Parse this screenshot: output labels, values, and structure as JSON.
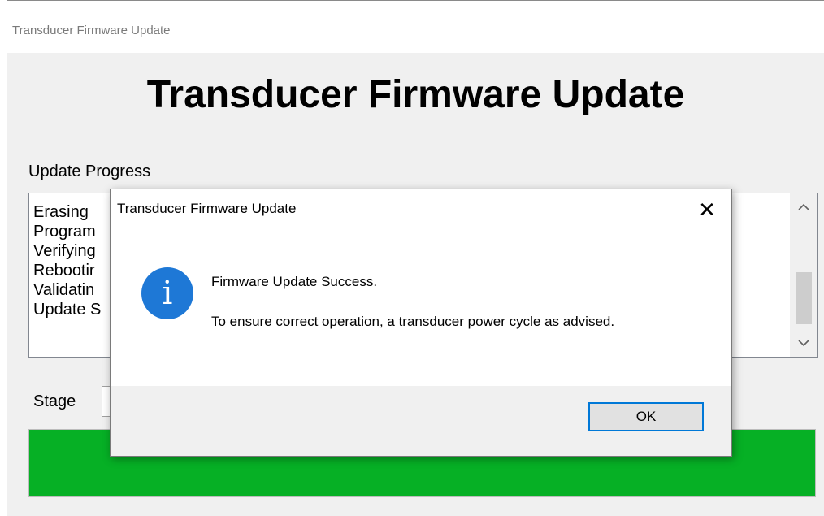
{
  "window": {
    "title": "Transducer Firmware Update",
    "heading": "Transducer Firmware Update"
  },
  "progress": {
    "label": "Update Progress",
    "items": [
      "Erasing",
      "Program",
      "Verifying",
      "Rebootir",
      "Validatin",
      "Update S"
    ],
    "scroll_up_icon": "chevron-up-icon",
    "scroll_down_icon": "chevron-down-icon"
  },
  "stage": {
    "label": "Stage",
    "value": "",
    "progress_fraction": 1.0,
    "progress_color": "#06b025"
  },
  "dialog": {
    "title": "Transducer Firmware Update",
    "icon": "info-icon",
    "icon_color": "#1e78d6",
    "icon_glyph": "i",
    "close_glyph": "✕",
    "message_line1": "Firmware Update Success.",
    "message_line2": "To ensure correct operation, a transducer power cycle as advised.",
    "ok_label": "OK"
  }
}
